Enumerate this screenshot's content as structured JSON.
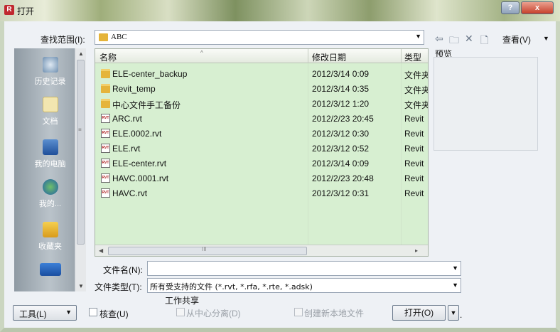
{
  "window": {
    "title": "打开",
    "app_icon": "R",
    "help_label": "?",
    "close_label": "x"
  },
  "lookin": {
    "label": "查找范围(I):",
    "value": "ABC"
  },
  "toolbar": {
    "view_label": "查看(V)"
  },
  "places": [
    {
      "label": "历史记录",
      "icon": "history-icon"
    },
    {
      "label": "文档",
      "icon": "documents-icon"
    },
    {
      "label": "我的电脑",
      "icon": "computer-icon"
    },
    {
      "label": "我的...",
      "icon": "network-icon"
    },
    {
      "label": "收藏夹",
      "icon": "favorites-icon"
    }
  ],
  "columns": {
    "name": "名称",
    "date": "修改日期",
    "type": "类型"
  },
  "files": [
    {
      "name": "ELE-center_backup",
      "date": "2012/3/14 0:09",
      "type": "文件夹",
      "kind": "folder"
    },
    {
      "name": "Revit_temp",
      "date": "2012/3/14 0:35",
      "type": "文件夹",
      "kind": "folder"
    },
    {
      "name": "中心文件手工备份",
      "date": "2012/3/12 1:20",
      "type": "文件夹",
      "kind": "folder"
    },
    {
      "name": "ARC.rvt",
      "date": "2012/2/23 20:45",
      "type": "Revit",
      "kind": "rvt"
    },
    {
      "name": "ELE.0002.rvt",
      "date": "2012/3/12 0:30",
      "type": "Revit",
      "kind": "rvt"
    },
    {
      "name": "ELE.rvt",
      "date": "2012/3/12 0:52",
      "type": "Revit",
      "kind": "rvt"
    },
    {
      "name": "ELE-center.rvt",
      "date": "2012/3/14 0:09",
      "type": "Revit",
      "kind": "rvt"
    },
    {
      "name": "HAVC.0001.rvt",
      "date": "2012/2/23 20:48",
      "type": "Revit",
      "kind": "rvt"
    },
    {
      "name": "HAVC.rvt",
      "date": "2012/3/12 0:31",
      "type": "Revit",
      "kind": "rvt"
    }
  ],
  "preview": {
    "label": "预览"
  },
  "filename": {
    "label": "文件名(N):",
    "value": ""
  },
  "filetype": {
    "label": "文件类型(T):",
    "value": "所有受支持的文件 (*.rvt, *.rfa, *.rte, *.adsk)"
  },
  "bottom": {
    "tools_label": "工具(L)",
    "audit_label": "核查(U)",
    "worksharing_label": "工作共享",
    "detach_label": "从中心分离(D)",
    "create_local_label": "创建新本地文件",
    "open_label": "打开(O)"
  },
  "colors": {
    "list_bg": "#d7efd1",
    "places_bg": "#a5afb8",
    "close": "#c7402b"
  }
}
